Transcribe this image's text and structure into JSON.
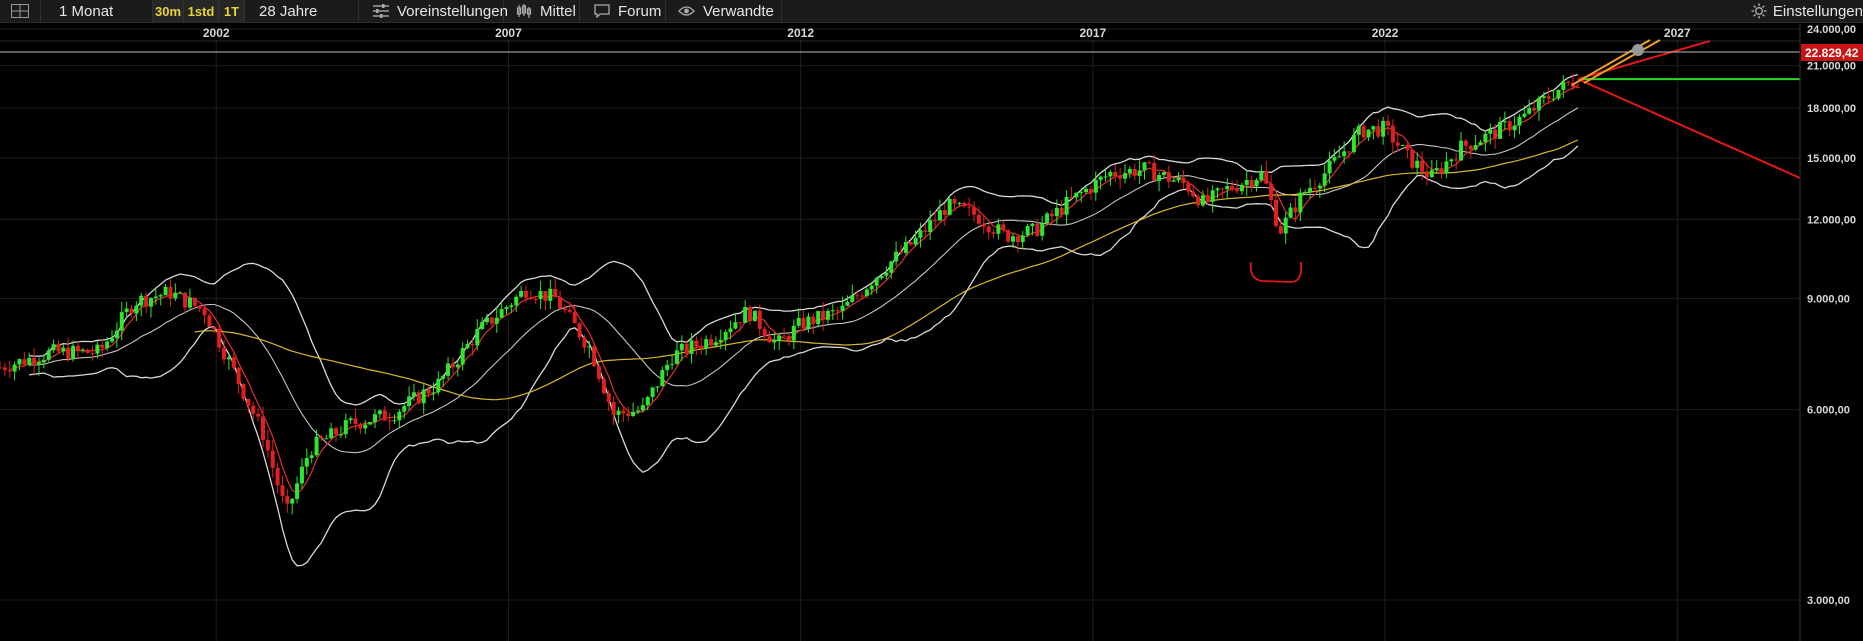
{
  "toolbar": {
    "period": "1 Monat",
    "intervals": [
      "30m",
      "1std",
      "1T"
    ],
    "range": "28 Jahre",
    "presets": "Voreinstellungen",
    "indicator": "Mittel",
    "forum": "Forum",
    "related": "Verwandte",
    "settings": "Einstellungen"
  },
  "colors": {
    "background": "#000000",
    "up": "#2ee62e",
    "down": "#e02020",
    "bollinger": "#d8d8d8",
    "sma_short": "#e03030",
    "sma_long": "#d8b830",
    "support": "#22dd22",
    "trend_down": "#e01818",
    "trend_up": "#f0a030",
    "price_badge": "#c81414"
  },
  "chart_data": {
    "type": "candlestick",
    "x_ticks": [
      "2002",
      "2007",
      "2012",
      "2017",
      "2022",
      "2027"
    ],
    "y_ticks": [
      "24.000,00",
      "21.000,00",
      "18.000,00",
      "15.000,00",
      "12.000,00",
      "9.000,00",
      "6.000,00",
      "3.000,00"
    ],
    "y_scale": "log",
    "ylim": [
      2700,
      25000
    ],
    "xlim": [
      1998.3,
      2029.1
    ],
    "last_price_label": "22.829,42",
    "last_price": 22829.42,
    "support_level": 20000,
    "series_path": [
      [
        1998.3,
        7000
      ],
      [
        1999.2,
        7400
      ],
      [
        2000.0,
        7400
      ],
      [
        2000.6,
        8900
      ],
      [
        2001.2,
        9200
      ],
      [
        2001.8,
        8600
      ],
      [
        2002.3,
        6900
      ],
      [
        2002.8,
        5500
      ],
      [
        2003.2,
        4100
      ],
      [
        2003.6,
        5200
      ],
      [
        2004.3,
        5700
      ],
      [
        2005.0,
        5900
      ],
      [
        2005.8,
        6600
      ],
      [
        2006.5,
        8000
      ],
      [
        2007.3,
        9300
      ],
      [
        2007.8,
        9000
      ],
      [
        2008.4,
        7500
      ],
      [
        2008.8,
        5900
      ],
      [
        2009.3,
        6000
      ],
      [
        2009.8,
        7300
      ],
      [
        2010.5,
        7800
      ],
      [
        2011.1,
        8600
      ],
      [
        2011.6,
        7600
      ],
      [
        2012.0,
        8200
      ],
      [
        2012.7,
        8600
      ],
      [
        2013.4,
        10000
      ],
      [
        2014.0,
        11200
      ],
      [
        2014.5,
        12600
      ],
      [
        2015.0,
        12200
      ],
      [
        2015.5,
        11300
      ],
      [
        2016.0,
        11500
      ],
      [
        2016.6,
        12800
      ],
      [
        2017.3,
        14200
      ],
      [
        2017.9,
        14400
      ],
      [
        2018.6,
        13600
      ],
      [
        2018.9,
        12700
      ],
      [
        2019.3,
        13400
      ],
      [
        2019.9,
        14200
      ],
      [
        2020.2,
        11500
      ],
      [
        2020.6,
        13200
      ],
      [
        2021.0,
        14300
      ],
      [
        2021.6,
        16600
      ],
      [
        2022.0,
        16700
      ],
      [
        2022.4,
        15000
      ],
      [
        2022.8,
        14000
      ],
      [
        2023.3,
        15600
      ],
      [
        2023.9,
        16500
      ],
      [
        2024.4,
        17500
      ],
      [
        2024.9,
        19100
      ],
      [
        2025.3,
        20000
      ]
    ],
    "annotation": "bracket marking 2020 low"
  }
}
